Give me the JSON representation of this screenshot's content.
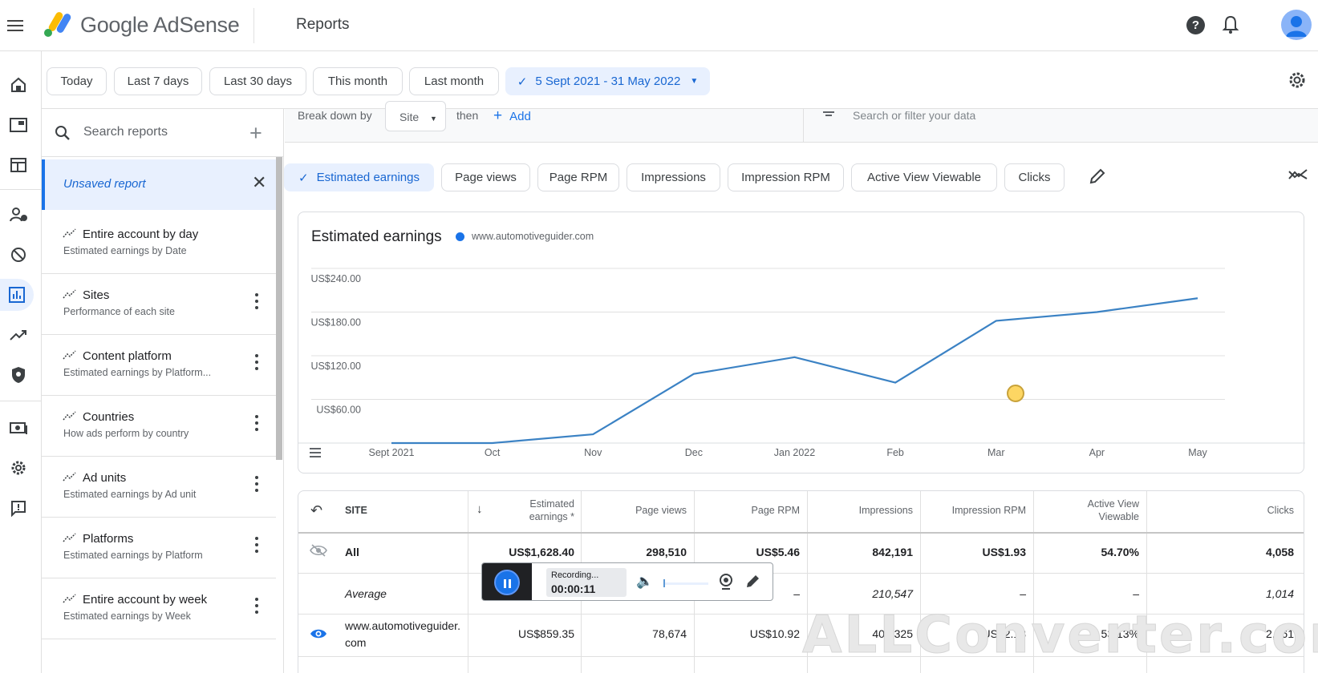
{
  "app": {
    "brand": "Google AdSense",
    "page_title": "Reports"
  },
  "date_filters": [
    {
      "label": "Today"
    },
    {
      "label": "Last 7 days"
    },
    {
      "label": "Last 30 days"
    },
    {
      "label": "This month"
    },
    {
      "label": "Last month"
    },
    {
      "label": "5 Sept 2021 - 31 May 2022",
      "selected": true
    }
  ],
  "reports_panel": {
    "search_placeholder": "Search reports",
    "unsaved_label": "Unsaved report",
    "items": [
      {
        "title": "Entire account by day",
        "subtitle": "Estimated earnings by Date"
      },
      {
        "title": "Sites",
        "subtitle": "Performance of each site"
      },
      {
        "title": "Content platform",
        "subtitle": "Estimated earnings by Platform..."
      },
      {
        "title": "Countries",
        "subtitle": "How ads perform by country"
      },
      {
        "title": "Ad units",
        "subtitle": "Estimated earnings by Ad unit"
      },
      {
        "title": "Platforms",
        "subtitle": "Estimated earnings by Platform"
      },
      {
        "title": "Entire account by week",
        "subtitle": "Estimated earnings by Week"
      }
    ]
  },
  "breakdown": {
    "label": "Break down by",
    "dimension": "Site",
    "then_label": "then",
    "add_label": "Add",
    "filter_placeholder": "Search or filter your data"
  },
  "metrics": [
    {
      "label": "Estimated earnings",
      "selected": true
    },
    {
      "label": "Page views"
    },
    {
      "label": "Page RPM"
    },
    {
      "label": "Impressions"
    },
    {
      "label": "Impression RPM"
    },
    {
      "label": "Active View Viewable"
    },
    {
      "label": "Clicks"
    }
  ],
  "chart": {
    "title": "Estimated earnings",
    "legend_label": "www.automotiveguider.com",
    "line_color": "#3b82c4"
  },
  "chart_data": {
    "type": "line",
    "title": "Estimated earnings",
    "series": [
      {
        "name": "www.automotiveguider.com",
        "values": [
          0,
          0,
          12,
          95,
          118,
          83,
          168,
          180,
          199
        ]
      }
    ],
    "x": [
      "Sept 2021",
      "Oct",
      "Nov",
      "Dec",
      "Jan 2022",
      "Feb",
      "Mar",
      "Apr",
      "May"
    ],
    "y_ticks": [
      "US$60.00",
      "US$120.00",
      "US$180.00",
      "US$240.00"
    ],
    "ylim": [
      0,
      240
    ],
    "grid": true,
    "legend": "top-left"
  },
  "table": {
    "headers": {
      "site": "SITE",
      "estimated_earnings": "Estimated earnings *",
      "page_views": "Page views",
      "page_rpm": "Page RPM",
      "impressions": "Impressions",
      "impression_rpm": "Impression RPM",
      "active_view": "Active View Viewable",
      "clicks": "Clicks"
    },
    "total": {
      "label": "All",
      "estimated_earnings": "US$1,628.40",
      "page_views": "298,510",
      "page_rpm": "US$5.46",
      "impressions": "842,191",
      "impression_rpm": "US$1.93",
      "active_view": "54.70%",
      "clicks": "4,058"
    },
    "average": {
      "label": "Average",
      "page_rpm": "–",
      "impressions": "210,547",
      "impression_rpm": "–",
      "active_view": "–",
      "clicks": "1,014"
    },
    "rows": [
      {
        "site": "www.automotiveguider.com",
        "estimated_earnings": "US$859.35",
        "page_views": "78,674",
        "page_rpm": "US$10.92",
        "impressions": "404,325",
        "impression_rpm": "US$2.13",
        "active_view": "53.13%",
        "clicks": "2,261"
      }
    ]
  },
  "recorder": {
    "status": "Recording...",
    "time": "00:00:11"
  },
  "watermark": "ALLConverter.com"
}
